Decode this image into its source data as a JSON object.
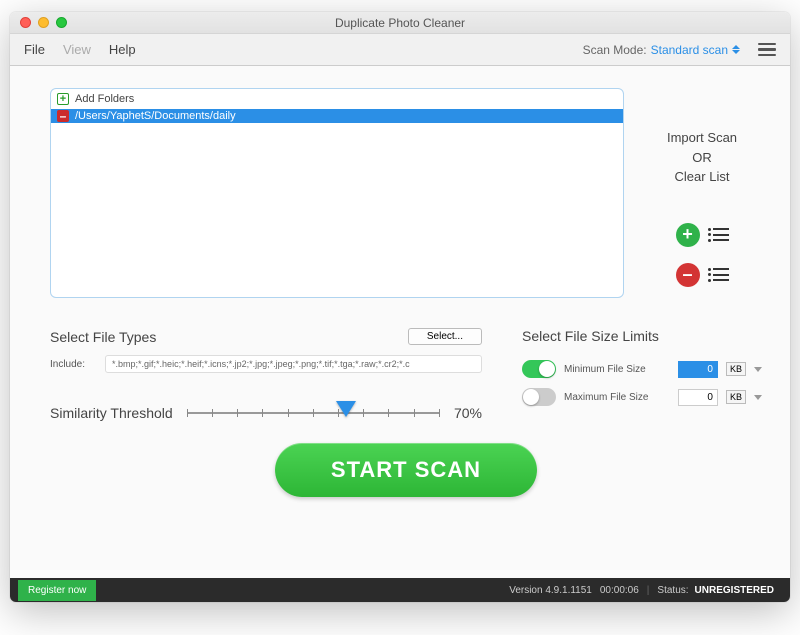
{
  "titlebar": {
    "title": "Duplicate Photo Cleaner"
  },
  "menu": {
    "file": "File",
    "view": "View",
    "help": "Help",
    "scanmode_label": "Scan Mode:",
    "scanmode_value": "Standard scan"
  },
  "folders": {
    "add_label": "Add Folders",
    "items": [
      "/Users/YaphetS/Documents/daily"
    ]
  },
  "side": {
    "line1": "Import Scan",
    "line2": "OR",
    "line3": "Clear List"
  },
  "filetypes": {
    "heading": "Select File Types",
    "select_btn": "Select...",
    "include_label": "Include:",
    "include_value": "*.bmp;*.gif;*.heic;*.heif;*.icns;*.jp2;*.jpg;*.jpeg;*.png;*.tif;*.tga;*.raw;*.cr2;*.c"
  },
  "threshold": {
    "heading": "Similarity Threshold",
    "percent": "70%"
  },
  "limits": {
    "heading": "Select File Size Limits",
    "min_label": "Minimum File Size",
    "min_value": "0",
    "min_unit": "KB",
    "max_label": "Maximum File Size",
    "max_value": "0",
    "max_unit": "KB"
  },
  "start_btn": "START SCAN",
  "footer": {
    "register": "Register now",
    "version": "Version 4.9.1.1151",
    "time": "00:00:06",
    "status_label": "Status:",
    "status_value": "UNREGISTERED"
  }
}
